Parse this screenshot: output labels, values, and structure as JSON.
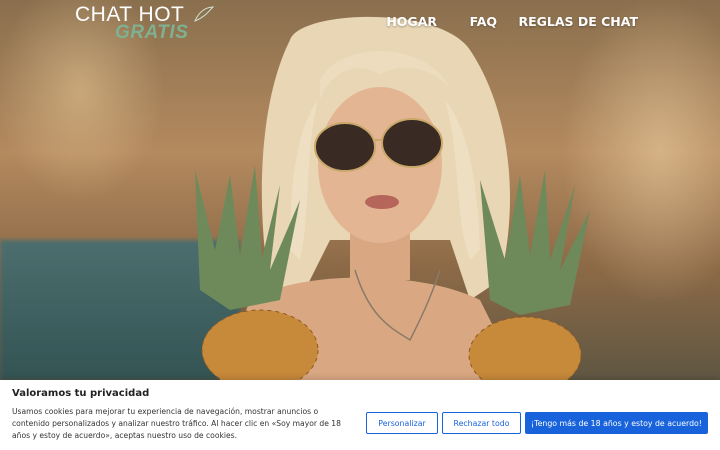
{
  "brand": {
    "logo_top": "CHAT HOT",
    "logo_bottom": "GRATIS",
    "accent_color": "#7fb090"
  },
  "nav": {
    "items": [
      {
        "label": "HOGAR"
      },
      {
        "label": "FAQ"
      },
      {
        "label": "REGLAS DE CHAT"
      }
    ]
  },
  "hero": {
    "image": "woman-with-sunglasses-holding-pineapples"
  },
  "cookie_banner": {
    "title": "Valoramos tu privacidad",
    "text": "Usamos cookies para mejorar tu experiencia de navegación, mostrar anuncios o contenido personalizados y analizar nuestro tráfico. Al hacer clic en «Soy mayor de 18 años y estoy de acuerdo», aceptas nuestro uso de cookies.",
    "buttons": {
      "customize": "Personalizar",
      "reject": "Rechazar todo",
      "accept": "¡Tengo más de 18 años y estoy de acuerdo!"
    },
    "button_color": "#1863dc"
  }
}
